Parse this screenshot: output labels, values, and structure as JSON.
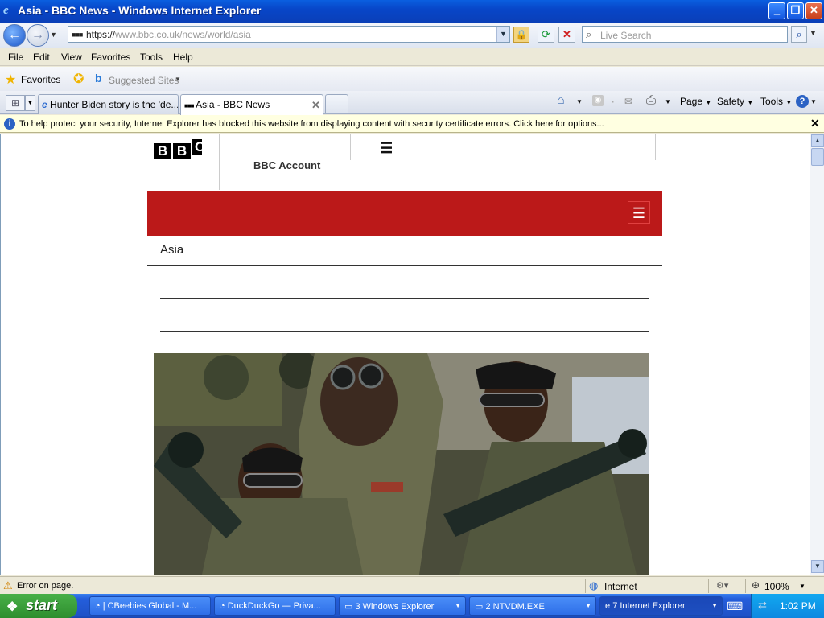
{
  "window": {
    "title": "Asia - BBC News - Windows Internet Explorer",
    "min": "_",
    "max": "❐",
    "close": "✕"
  },
  "nav": {
    "back": "←",
    "forward": "→",
    "url_scheme": "https://",
    "url_host": "www.bbc.co.uk",
    "url_path": "/news/world/asia",
    "search_placeholder": "Live Search"
  },
  "menu": [
    "File",
    "Edit",
    "View",
    "Favorites",
    "Tools",
    "Help"
  ],
  "favorites_bar": {
    "favorites_label": "Favorites",
    "suggested_label": "Suggested Sites"
  },
  "tabs": [
    {
      "label": "Hunter Biden story is the 'de..."
    },
    {
      "label": "Asia - BBC News"
    }
  ],
  "command_bar": {
    "page": "Page",
    "safety": "Safety",
    "tools": "Tools"
  },
  "infobar": {
    "message": "To help protect your security, Internet Explorer has blocked this website from displaying content with security certificate errors. Click here for options..."
  },
  "page": {
    "logo": [
      "B",
      "B",
      "C"
    ],
    "account_label": "BBC Account",
    "section_title": "Asia"
  },
  "statusbar": {
    "error": "Error on page.",
    "zone": "Internet",
    "zoom": "100%"
  },
  "taskbar": {
    "start": "start",
    "tasks": [
      {
        "label": "| CBeebies Global - M..."
      },
      {
        "label": "DuckDuckGo — Priva..."
      },
      {
        "label": "3 Windows Explorer"
      },
      {
        "label": "2 NTVDM.EXE"
      },
      {
        "label": "7 Internet Explorer"
      }
    ],
    "clock": "1:02 PM"
  },
  "colors": {
    "bbc_red": "#bb1919",
    "xp_blue": "#245edb",
    "start_green": "#3a9a3a"
  }
}
